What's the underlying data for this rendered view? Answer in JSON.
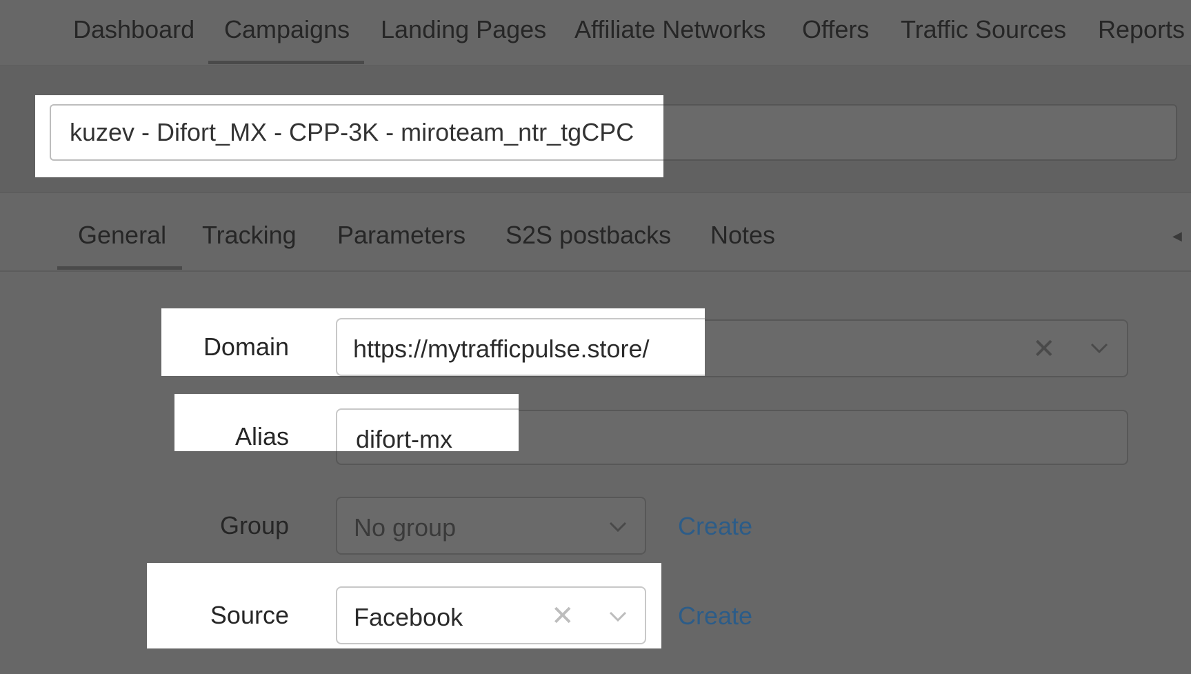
{
  "nav": {
    "items": [
      {
        "label": "Dashboard"
      },
      {
        "label": "Campaigns"
      },
      {
        "label": "Landing Pages"
      },
      {
        "label": "Affiliate Networks"
      },
      {
        "label": "Offers"
      },
      {
        "label": "Traffic Sources"
      },
      {
        "label": "Reports"
      }
    ],
    "active": "Campaigns"
  },
  "campaign": {
    "name": "kuzev - Difort_MX - CPP-3K - miroteam_ntr_tgCPC"
  },
  "tabs": {
    "items": [
      {
        "label": "General"
      },
      {
        "label": "Tracking"
      },
      {
        "label": "Parameters"
      },
      {
        "label": "S2S postbacks"
      },
      {
        "label": "Notes"
      }
    ],
    "active": "General"
  },
  "form": {
    "domain": {
      "label": "Domain",
      "value": "https://mytrafficpulse.store/"
    },
    "alias": {
      "label": "Alias",
      "value": "difort-mx"
    },
    "group": {
      "label": "Group",
      "value": "No group",
      "create_label": "Create"
    },
    "source": {
      "label": "Source",
      "value": "Facebook",
      "create_label": "Create"
    }
  },
  "colors": {
    "overlay_background": "#676767",
    "link": "#2c5c88",
    "highlight": "#ffffff"
  },
  "icons": {
    "clear": "close-icon",
    "dropdown": "chevron-down-icon",
    "scroll": "caret-left-icon"
  }
}
